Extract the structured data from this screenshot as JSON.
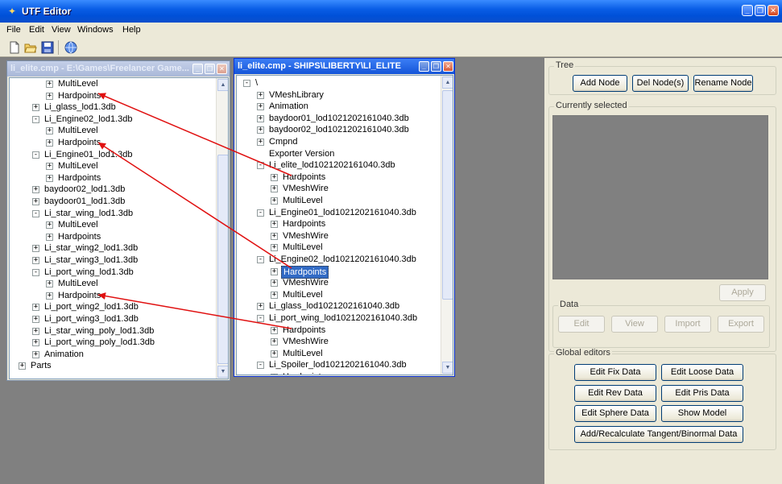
{
  "app": {
    "title": "UTF Editor",
    "accent": "#0a5ee6"
  },
  "window_buttons": [
    "minimize-icon",
    "restore-icon",
    "close-icon"
  ],
  "menu": [
    "File",
    "Edit",
    "View",
    "Windows",
    "Help"
  ],
  "toolbar": [
    "new-file-icon",
    "open-folder-icon",
    "save-icon",
    "globe-icon"
  ],
  "left_window": {
    "title": "li_elite.cmp - E:\\Games\\Freelancer Game...",
    "items": [
      {
        "label": "MultiLevel",
        "depth": 2,
        "state": "+"
      },
      {
        "label": "Hardpoints",
        "depth": 2,
        "state": "+"
      },
      {
        "label": "Li_glass_lod1.3db",
        "depth": 1,
        "state": "+"
      },
      {
        "label": "Li_Engine02_lod1.3db",
        "depth": 1,
        "state": "-"
      },
      {
        "label": "MultiLevel",
        "depth": 2,
        "state": "+"
      },
      {
        "label": "Hardpoints",
        "depth": 2,
        "state": "+"
      },
      {
        "label": "Li_Engine01_lod1.3db",
        "depth": 1,
        "state": "-"
      },
      {
        "label": "MultiLevel",
        "depth": 2,
        "state": "+"
      },
      {
        "label": "Hardpoints",
        "depth": 2,
        "state": "+"
      },
      {
        "label": "baydoor02_lod1.3db",
        "depth": 1,
        "state": "+"
      },
      {
        "label": "baydoor01_lod1.3db",
        "depth": 1,
        "state": "+"
      },
      {
        "label": "Li_star_wing_lod1.3db",
        "depth": 1,
        "state": "-"
      },
      {
        "label": "MultiLevel",
        "depth": 2,
        "state": "+"
      },
      {
        "label": "Hardpoints",
        "depth": 2,
        "state": "+"
      },
      {
        "label": "Li_star_wing2_lod1.3db",
        "depth": 1,
        "state": "+"
      },
      {
        "label": "Li_star_wing3_lod1.3db",
        "depth": 1,
        "state": "+"
      },
      {
        "label": "Li_port_wing_lod1.3db",
        "depth": 1,
        "state": "-"
      },
      {
        "label": "MultiLevel",
        "depth": 2,
        "state": "+"
      },
      {
        "label": "Hardpoints",
        "depth": 2,
        "state": "+"
      },
      {
        "label": "Li_port_wing2_lod1.3db",
        "depth": 1,
        "state": "+"
      },
      {
        "label": "Li_port_wing3_lod1.3db",
        "depth": 1,
        "state": "+"
      },
      {
        "label": "Li_star_wing_poly_lod1.3db",
        "depth": 1,
        "state": "+"
      },
      {
        "label": "Li_port_wing_poly_lod1.3db",
        "depth": 1,
        "state": "+"
      },
      {
        "label": "Animation",
        "depth": 1,
        "state": "+"
      },
      {
        "label": "Parts",
        "depth": 0,
        "state": "+"
      }
    ]
  },
  "right_window": {
    "title": "li_elite.cmp - SHIPS\\LIBERTY\\LI_ELITE",
    "items": [
      {
        "label": "\\",
        "depth": 0,
        "state": "-"
      },
      {
        "label": "VMeshLibrary",
        "depth": 1,
        "state": "+"
      },
      {
        "label": "Animation",
        "depth": 1,
        "state": "+"
      },
      {
        "label": "baydoor01_lod1021202161040.3db",
        "depth": 1,
        "state": "+"
      },
      {
        "label": "baydoor02_lod1021202161040.3db",
        "depth": 1,
        "state": "+"
      },
      {
        "label": "Cmpnd",
        "depth": 1,
        "state": "+"
      },
      {
        "label": "Exporter Version",
        "depth": 1,
        "state": ""
      },
      {
        "label": "Li_elite_lod1021202161040.3db",
        "depth": 1,
        "state": "-"
      },
      {
        "label": "Hardpoints",
        "depth": 2,
        "state": "+"
      },
      {
        "label": "VMeshWire",
        "depth": 2,
        "state": "+"
      },
      {
        "label": "MultiLevel",
        "depth": 2,
        "state": "+"
      },
      {
        "label": "Li_Engine01_lod1021202161040.3db",
        "depth": 1,
        "state": "-"
      },
      {
        "label": "Hardpoints",
        "depth": 2,
        "state": "+"
      },
      {
        "label": "VMeshWire",
        "depth": 2,
        "state": "+"
      },
      {
        "label": "MultiLevel",
        "depth": 2,
        "state": "+"
      },
      {
        "label": "Li_Engine02_lod1021202161040.3db",
        "depth": 1,
        "state": "-"
      },
      {
        "label": "Hardpoints",
        "depth": 2,
        "state": "+",
        "selected": true
      },
      {
        "label": "VMeshWire",
        "depth": 2,
        "state": "+"
      },
      {
        "label": "MultiLevel",
        "depth": 2,
        "state": "+"
      },
      {
        "label": "Li_glass_lod1021202161040.3db",
        "depth": 1,
        "state": "+"
      },
      {
        "label": "Li_port_wing_lod1021202161040.3db",
        "depth": 1,
        "state": "-"
      },
      {
        "label": "Hardpoints",
        "depth": 2,
        "state": "+"
      },
      {
        "label": "VMeshWire",
        "depth": 2,
        "state": "+"
      },
      {
        "label": "MultiLevel",
        "depth": 2,
        "state": "+"
      },
      {
        "label": "Li_Spoiler_lod1021202161040.3db",
        "depth": 1,
        "state": "-"
      },
      {
        "label": "Hardpoints",
        "depth": 2,
        "state": "+"
      }
    ]
  },
  "panel": {
    "tree_group": "Tree",
    "add_node": "Add Node",
    "del_node": "Del Node(s)",
    "rename_node": "Rename Node",
    "selected_group": "Currently selected",
    "apply": "Apply",
    "data_group": "Data",
    "edit": "Edit",
    "view": "View",
    "import": "Import",
    "export": "Export",
    "global_group": "Global editors",
    "edit_fix": "Edit Fix Data",
    "edit_loose": "Edit Loose Data",
    "edit_rev": "Edit Rev Data",
    "edit_pris": "Edit Pris Data",
    "edit_sphere": "Edit Sphere Data",
    "show_model": "Show Model",
    "tangent": "Add/Recalculate Tangent/Binormal Data"
  },
  "annotation_color": "#e01010"
}
